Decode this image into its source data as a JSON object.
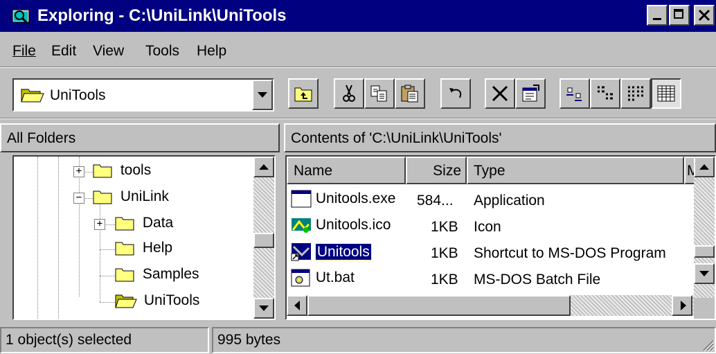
{
  "window": {
    "title": "Exploring - C:\\UniLink\\UniTools",
    "controls": {
      "minimize": "_",
      "maximize": "□",
      "close": "✕"
    }
  },
  "menu": [
    {
      "label": "File"
    },
    {
      "label": "Edit"
    },
    {
      "label": "View"
    },
    {
      "label": "Tools"
    },
    {
      "label": "Help"
    }
  ],
  "address": {
    "value": "UniTools",
    "icon": "folder-open-icon"
  },
  "toolbar": {
    "icons": [
      "up-folder-icon",
      "cut-icon",
      "copy-icon",
      "paste-icon",
      "undo-icon",
      "delete-icon",
      "properties-icon",
      "large-icons-icon",
      "small-icons-icon",
      "list-icon",
      "details-icon"
    ]
  },
  "panes": {
    "left_header": "All Folders",
    "right_header": "Contents of 'C:\\UniLink\\UniTools'"
  },
  "tree": [
    {
      "label": "tools",
      "expander": "+"
    },
    {
      "label": "UniLink",
      "expander": "−"
    },
    {
      "label": "Data",
      "expander": "+"
    },
    {
      "label": "Help"
    },
    {
      "label": "Samples"
    },
    {
      "label": "UniTools"
    }
  ],
  "columns": {
    "name": "Name",
    "size": "Size",
    "type": "Type",
    "modified": "M"
  },
  "files": [
    {
      "name": "Unitools.exe",
      "size": "584...",
      "type": "Application",
      "icon": "application-icon"
    },
    {
      "name": "Unitools.ico",
      "size": "1KB",
      "type": "Icon",
      "icon": "icon-file-icon"
    },
    {
      "name": "Unitools",
      "size": "1KB",
      "type": "Shortcut to MS-DOS Program",
      "icon": "msdos-shortcut-icon",
      "selected": true
    },
    {
      "name": "Ut.bat",
      "size": "1KB",
      "type": "MS-DOS Batch File",
      "icon": "batch-file-icon"
    }
  ],
  "status": {
    "selection": "1 object(s) selected",
    "size": "995 bytes"
  },
  "colors": {
    "titlebar": "#000080",
    "face": "#c0c0c0",
    "selection": "#000080",
    "folder": "#ffff80"
  }
}
